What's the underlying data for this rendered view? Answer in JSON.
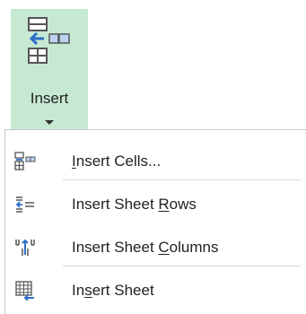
{
  "ribbon": {
    "insert_label": "Insert",
    "icon": "insert-cells-icon",
    "accent_color": "#c6e9d2"
  },
  "menu": {
    "items": [
      {
        "label_pre": "",
        "label_u": "I",
        "label_post": "nsert Cells...",
        "icon": "insert-cells-icon"
      },
      {
        "label_pre": "Insert Sheet ",
        "label_u": "R",
        "label_post": "ows",
        "icon": "insert-rows-icon"
      },
      {
        "label_pre": "Insert Sheet ",
        "label_u": "C",
        "label_post": "olumns",
        "icon": "insert-columns-icon"
      },
      {
        "label_pre": "In",
        "label_u": "s",
        "label_post": "ert Sheet",
        "icon": "insert-sheet-icon"
      }
    ]
  }
}
